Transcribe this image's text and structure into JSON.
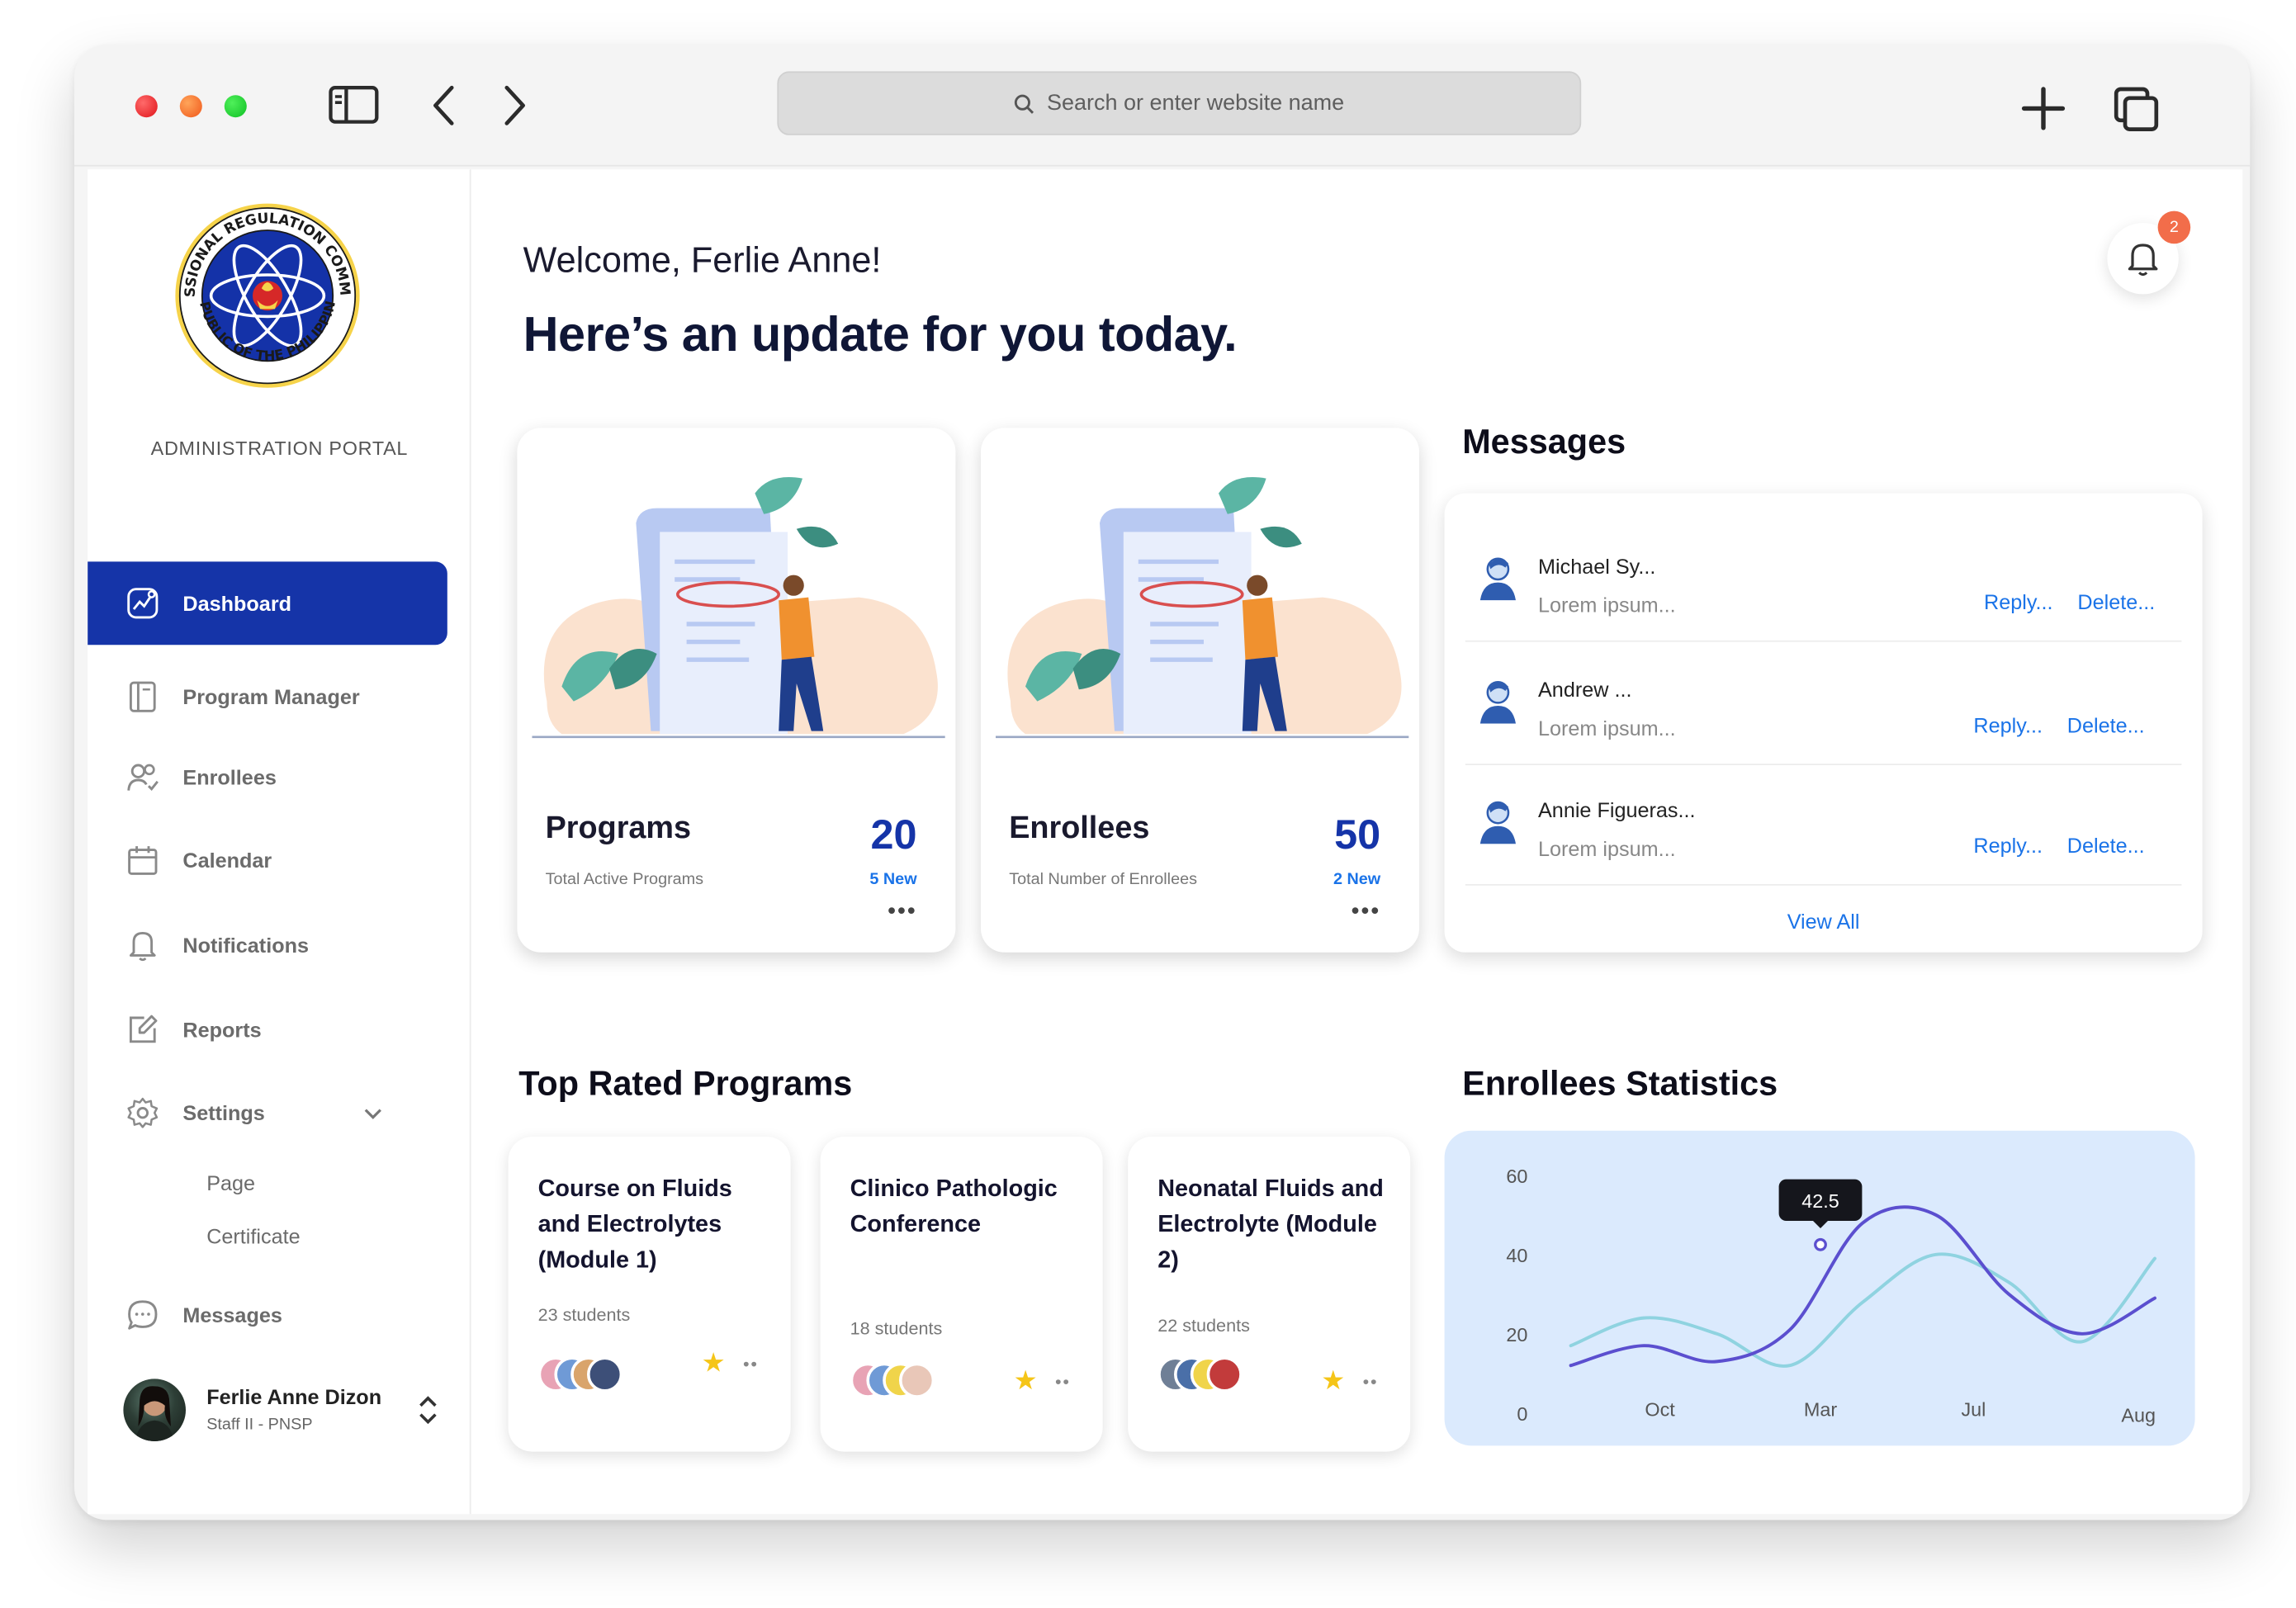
{
  "browser": {
    "url_placeholder": "Search or enter website name"
  },
  "sidebar": {
    "portal_label": "ADMINISTRATION PORTAL",
    "items": [
      {
        "label": "Dashboard",
        "icon": "chart-line-icon",
        "active": true
      },
      {
        "label": "Program Manager",
        "icon": "notebook-icon"
      },
      {
        "label": "Enrollees",
        "icon": "users-icon"
      },
      {
        "label": "Calendar",
        "icon": "calendar-icon"
      },
      {
        "label": "Notifications",
        "icon": "bell-icon"
      },
      {
        "label": "Reports",
        "icon": "edit-icon"
      },
      {
        "label": "Settings",
        "icon": "gear-icon",
        "expanded": true
      },
      {
        "label": "Messages",
        "icon": "chat-icon"
      }
    ],
    "settings_sub": [
      "Page",
      "Certificate"
    ],
    "profile": {
      "name": "Ferlie Anne Dizon",
      "role": "Staff II - PNSP"
    }
  },
  "header": {
    "welcome": "Welcome, Ferlie Anne!",
    "headline": "Here’s an update for you today.",
    "notification_count": "2"
  },
  "stats": [
    {
      "title": "Programs",
      "subtitle": "Total Active Programs",
      "value": "20",
      "new": "5 New",
      "more": "•••"
    },
    {
      "title": "Enrollees",
      "subtitle": "Total Number of Enrollees",
      "value": "50",
      "new": "2 New",
      "more": "•••"
    }
  ],
  "messages": {
    "title": "Messages",
    "items": [
      {
        "name": "Michael Sy...",
        "preview": "Lorem ipsum...",
        "reply": "Reply...",
        "delete": "Delete..."
      },
      {
        "name": "Andrew ...",
        "preview": "Lorem ipsum...",
        "reply": "Reply...",
        "delete": "Delete..."
      },
      {
        "name": "Annie Figueras...",
        "preview": "Lorem ipsum...",
        "reply": "Reply...",
        "delete": "Delete..."
      }
    ],
    "view_all": "View All"
  },
  "top_programs": {
    "title": "Top Rated Programs",
    "items": [
      {
        "name": "Course on Fluids and Electrolytes (Module 1)",
        "students": "23 students"
      },
      {
        "name": "Clinico Pathologic Conference",
        "students": "18 students"
      },
      {
        "name": "Neonatal Fluids and Electrolyte (Module 2)",
        "students": "22 students"
      }
    ],
    "more": "••"
  },
  "colors": {
    "primary": "#1534a8",
    "link": "#1a73e8",
    "badge": "#f26d4a",
    "chart_bg": "#dbeafd",
    "series_dark": "#5b4fcf",
    "series_light": "#8fd3e0"
  },
  "chart_data": {
    "type": "line",
    "title": "Enrollees Statistics",
    "x_tick_labels": [
      "Oct",
      "Mar",
      "Jul",
      "Aug"
    ],
    "y_tick_labels": [
      "0",
      "20",
      "40",
      "60"
    ],
    "ylim": [
      0,
      60
    ],
    "tooltip": {
      "value": "42.5",
      "x": "Mar",
      "y": 42.5
    },
    "series": [
      {
        "points": [
          [
            0,
            12
          ],
          [
            1,
            17
          ],
          [
            2,
            13
          ],
          [
            3,
            21
          ],
          [
            4,
            48
          ],
          [
            5,
            50
          ],
          [
            6,
            30
          ],
          [
            7,
            20
          ],
          [
            8,
            29
          ]
        ],
        "color": "#5b4fcf"
      },
      {
        "points": [
          [
            0,
            17
          ],
          [
            1,
            24
          ],
          [
            2,
            20
          ],
          [
            3,
            12
          ],
          [
            4,
            28
          ],
          [
            5,
            40
          ],
          [
            6,
            33
          ],
          [
            7,
            18
          ],
          [
            8,
            39
          ]
        ],
        "color": "#8fd3e0"
      }
    ],
    "grid": false
  }
}
